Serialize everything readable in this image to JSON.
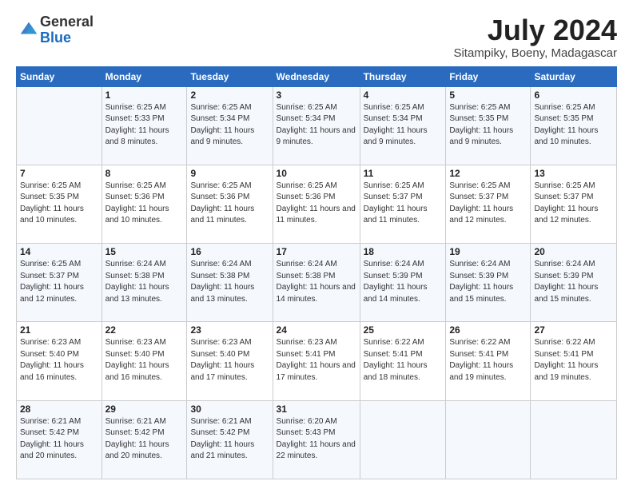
{
  "logo": {
    "general": "General",
    "blue": "Blue"
  },
  "header": {
    "month": "July 2024",
    "location": "Sitampiky, Boeny, Madagascar"
  },
  "days_header": [
    "Sunday",
    "Monday",
    "Tuesday",
    "Wednesday",
    "Thursday",
    "Friday",
    "Saturday"
  ],
  "weeks": [
    [
      {
        "day": "",
        "sunrise": "",
        "sunset": "",
        "daylight": ""
      },
      {
        "day": "1",
        "sunrise": "Sunrise: 6:25 AM",
        "sunset": "Sunset: 5:33 PM",
        "daylight": "Daylight: 11 hours and 8 minutes."
      },
      {
        "day": "2",
        "sunrise": "Sunrise: 6:25 AM",
        "sunset": "Sunset: 5:34 PM",
        "daylight": "Daylight: 11 hours and 9 minutes."
      },
      {
        "day": "3",
        "sunrise": "Sunrise: 6:25 AM",
        "sunset": "Sunset: 5:34 PM",
        "daylight": "Daylight: 11 hours and 9 minutes."
      },
      {
        "day": "4",
        "sunrise": "Sunrise: 6:25 AM",
        "sunset": "Sunset: 5:34 PM",
        "daylight": "Daylight: 11 hours and 9 minutes."
      },
      {
        "day": "5",
        "sunrise": "Sunrise: 6:25 AM",
        "sunset": "Sunset: 5:35 PM",
        "daylight": "Daylight: 11 hours and 9 minutes."
      },
      {
        "day": "6",
        "sunrise": "Sunrise: 6:25 AM",
        "sunset": "Sunset: 5:35 PM",
        "daylight": "Daylight: 11 hours and 10 minutes."
      }
    ],
    [
      {
        "day": "7",
        "sunrise": "Sunrise: 6:25 AM",
        "sunset": "Sunset: 5:35 PM",
        "daylight": "Daylight: 11 hours and 10 minutes."
      },
      {
        "day": "8",
        "sunrise": "Sunrise: 6:25 AM",
        "sunset": "Sunset: 5:36 PM",
        "daylight": "Daylight: 11 hours and 10 minutes."
      },
      {
        "day": "9",
        "sunrise": "Sunrise: 6:25 AM",
        "sunset": "Sunset: 5:36 PM",
        "daylight": "Daylight: 11 hours and 11 minutes."
      },
      {
        "day": "10",
        "sunrise": "Sunrise: 6:25 AM",
        "sunset": "Sunset: 5:36 PM",
        "daylight": "Daylight: 11 hours and 11 minutes."
      },
      {
        "day": "11",
        "sunrise": "Sunrise: 6:25 AM",
        "sunset": "Sunset: 5:37 PM",
        "daylight": "Daylight: 11 hours and 11 minutes."
      },
      {
        "day": "12",
        "sunrise": "Sunrise: 6:25 AM",
        "sunset": "Sunset: 5:37 PM",
        "daylight": "Daylight: 11 hours and 12 minutes."
      },
      {
        "day": "13",
        "sunrise": "Sunrise: 6:25 AM",
        "sunset": "Sunset: 5:37 PM",
        "daylight": "Daylight: 11 hours and 12 minutes."
      }
    ],
    [
      {
        "day": "14",
        "sunrise": "Sunrise: 6:25 AM",
        "sunset": "Sunset: 5:37 PM",
        "daylight": "Daylight: 11 hours and 12 minutes."
      },
      {
        "day": "15",
        "sunrise": "Sunrise: 6:24 AM",
        "sunset": "Sunset: 5:38 PM",
        "daylight": "Daylight: 11 hours and 13 minutes."
      },
      {
        "day": "16",
        "sunrise": "Sunrise: 6:24 AM",
        "sunset": "Sunset: 5:38 PM",
        "daylight": "Daylight: 11 hours and 13 minutes."
      },
      {
        "day": "17",
        "sunrise": "Sunrise: 6:24 AM",
        "sunset": "Sunset: 5:38 PM",
        "daylight": "Daylight: 11 hours and 14 minutes."
      },
      {
        "day": "18",
        "sunrise": "Sunrise: 6:24 AM",
        "sunset": "Sunset: 5:39 PM",
        "daylight": "Daylight: 11 hours and 14 minutes."
      },
      {
        "day": "19",
        "sunrise": "Sunrise: 6:24 AM",
        "sunset": "Sunset: 5:39 PM",
        "daylight": "Daylight: 11 hours and 15 minutes."
      },
      {
        "day": "20",
        "sunrise": "Sunrise: 6:24 AM",
        "sunset": "Sunset: 5:39 PM",
        "daylight": "Daylight: 11 hours and 15 minutes."
      }
    ],
    [
      {
        "day": "21",
        "sunrise": "Sunrise: 6:23 AM",
        "sunset": "Sunset: 5:40 PM",
        "daylight": "Daylight: 11 hours and 16 minutes."
      },
      {
        "day": "22",
        "sunrise": "Sunrise: 6:23 AM",
        "sunset": "Sunset: 5:40 PM",
        "daylight": "Daylight: 11 hours and 16 minutes."
      },
      {
        "day": "23",
        "sunrise": "Sunrise: 6:23 AM",
        "sunset": "Sunset: 5:40 PM",
        "daylight": "Daylight: 11 hours and 17 minutes."
      },
      {
        "day": "24",
        "sunrise": "Sunrise: 6:23 AM",
        "sunset": "Sunset: 5:41 PM",
        "daylight": "Daylight: 11 hours and 17 minutes."
      },
      {
        "day": "25",
        "sunrise": "Sunrise: 6:22 AM",
        "sunset": "Sunset: 5:41 PM",
        "daylight": "Daylight: 11 hours and 18 minutes."
      },
      {
        "day": "26",
        "sunrise": "Sunrise: 6:22 AM",
        "sunset": "Sunset: 5:41 PM",
        "daylight": "Daylight: 11 hours and 19 minutes."
      },
      {
        "day": "27",
        "sunrise": "Sunrise: 6:22 AM",
        "sunset": "Sunset: 5:41 PM",
        "daylight": "Daylight: 11 hours and 19 minutes."
      }
    ],
    [
      {
        "day": "28",
        "sunrise": "Sunrise: 6:21 AM",
        "sunset": "Sunset: 5:42 PM",
        "daylight": "Daylight: 11 hours and 20 minutes."
      },
      {
        "day": "29",
        "sunrise": "Sunrise: 6:21 AM",
        "sunset": "Sunset: 5:42 PM",
        "daylight": "Daylight: 11 hours and 20 minutes."
      },
      {
        "day": "30",
        "sunrise": "Sunrise: 6:21 AM",
        "sunset": "Sunset: 5:42 PM",
        "daylight": "Daylight: 11 hours and 21 minutes."
      },
      {
        "day": "31",
        "sunrise": "Sunrise: 6:20 AM",
        "sunset": "Sunset: 5:43 PM",
        "daylight": "Daylight: 11 hours and 22 minutes."
      },
      {
        "day": "",
        "sunrise": "",
        "sunset": "",
        "daylight": ""
      },
      {
        "day": "",
        "sunrise": "",
        "sunset": "",
        "daylight": ""
      },
      {
        "day": "",
        "sunrise": "",
        "sunset": "",
        "daylight": ""
      }
    ]
  ]
}
